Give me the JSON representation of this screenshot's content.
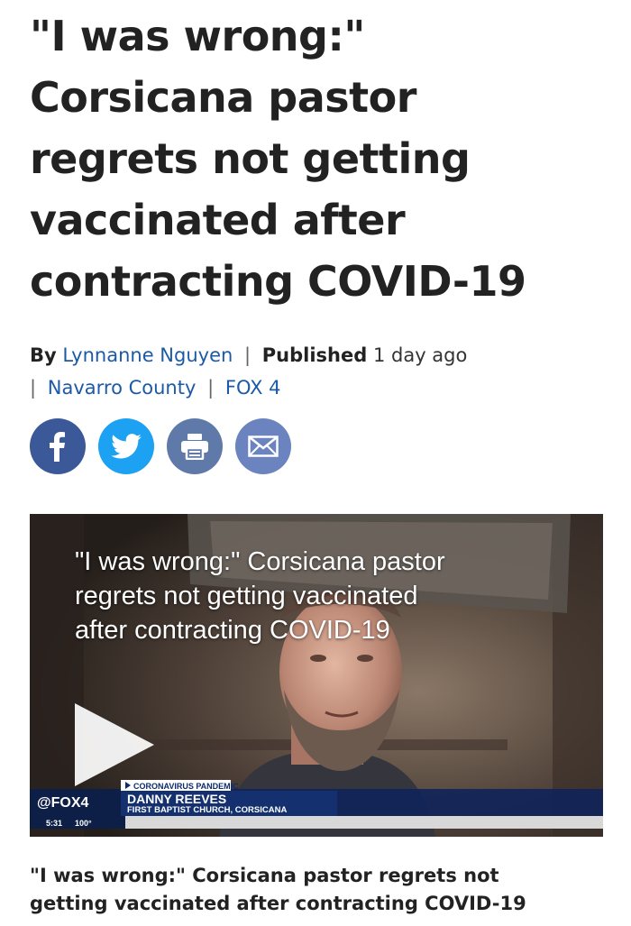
{
  "article": {
    "headline_lines": [
      "\"I was wrong:\"",
      "Corsicana pastor",
      "regrets not getting",
      "vaccinated after",
      "contracting COVID-19"
    ],
    "by_label": "By",
    "author": "Lynnanne Nguyen",
    "published_label": "Published",
    "published_time": "1 day ago",
    "location": "Navarro County",
    "source": "FOX 4"
  },
  "share": {
    "facebook_icon": "facebook-icon",
    "twitter_icon": "twitter-icon",
    "print_icon": "print-icon",
    "email_icon": "email-icon",
    "colors": {
      "facebook": "#3b5998",
      "twitter": "#1da1f2",
      "print": "#5f7aa8",
      "email": "#6b84bf"
    }
  },
  "video": {
    "overlay_title_lines": [
      "\"I was wrong:\" Corsicana pastor",
      "regrets not getting vaccinated",
      "after contracting COVID-19"
    ],
    "play_icon": "play-icon",
    "lower_third": {
      "station": "@FOX4",
      "topic": "CORONAVIRUS PANDEMIC",
      "name": "DANNY REEVES",
      "affiliation": "FIRST BAPTIST CHURCH, CORSICANA",
      "time": "5:31",
      "temperature": "100°"
    }
  },
  "caption": {
    "lines": [
      "\"I was wrong:\" Corsicana pastor regrets not",
      "getting vaccinated after contracting COVID-19"
    ]
  }
}
